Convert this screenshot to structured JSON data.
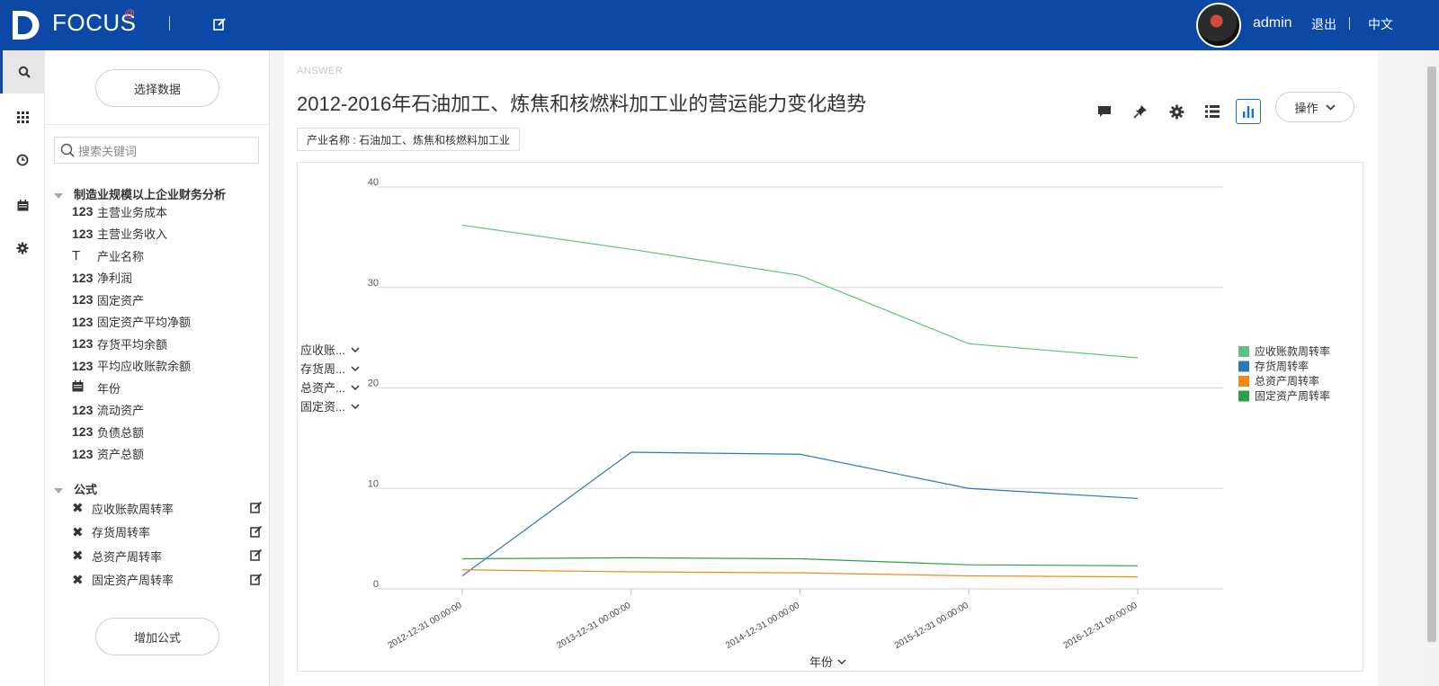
{
  "header": {
    "brand": "FOCUS",
    "brand_mark": "@",
    "user": "admin",
    "logout": "退出",
    "language": "中文"
  },
  "rail": {
    "items": [
      "search-icon",
      "apps-grid-icon",
      "history-clock-icon",
      "calendar-icon",
      "settings-gear-icon"
    ]
  },
  "panel": {
    "select_data_label": "选择数据",
    "search_placeholder": "搜索关键词",
    "dataset_title": "制造业规模以上企业财务分析",
    "fields": [
      {
        "type": "123",
        "label": "主营业务成本"
      },
      {
        "type": "123",
        "label": "主营业务收入"
      },
      {
        "type": "T",
        "label": "产业名称"
      },
      {
        "type": "123",
        "label": "净利润"
      },
      {
        "type": "123",
        "label": "固定资产"
      },
      {
        "type": "123",
        "label": "固定资产平均净额"
      },
      {
        "type": "123",
        "label": "存货平均余额"
      },
      {
        "type": "123",
        "label": "平均应收账款余额"
      },
      {
        "type": "date",
        "label": "年份"
      },
      {
        "type": "123",
        "label": "流动资产"
      },
      {
        "type": "123",
        "label": "负债总额"
      },
      {
        "type": "123",
        "label": "资产总额"
      }
    ],
    "formula_title": "公式",
    "formulas": [
      "应收账款周转率",
      "存货周转率",
      "总资产周转率",
      "固定资产周转率"
    ],
    "add_formula_label": "增加公式"
  },
  "main": {
    "answer_tag": "ANSWER",
    "title": "2012-2016年石油加工、炼焦和核燃料加工业的营运能力变化趋势",
    "filter_chip": "产业名称 : 石油加工、炼焦和核燃料加工业",
    "ops_label": "操作",
    "y_fields": [
      "应收账...",
      "存货周...",
      "总资产...",
      "固定资..."
    ],
    "x_field": "年份"
  },
  "chart_data": {
    "type": "line",
    "title": "",
    "xlabel": "年份",
    "ylabel": "",
    "ylim": [
      0,
      40
    ],
    "yticks": [
      0,
      10,
      20,
      30,
      40
    ],
    "grid": true,
    "legend_position": "right",
    "x": [
      "2012-12-31 00:00:00",
      "2013-12-31 00:00:00",
      "2014-12-31 00:00:00",
      "2015-12-31 00:00:00",
      "2016-12-31 00:00:00"
    ],
    "series": [
      {
        "name": "应收账款周转率",
        "color": "#5ec27d",
        "values": [
          36.2,
          33.8,
          31.2,
          24.4,
          23.0
        ]
      },
      {
        "name": "存货周转率",
        "color": "#2c77b8",
        "values": [
          1.3,
          13.6,
          13.4,
          10.0,
          9.0
        ]
      },
      {
        "name": "总资产周转率",
        "color": "#f08a1c",
        "values": [
          1.9,
          1.7,
          1.6,
          1.3,
          1.2
        ]
      },
      {
        "name": "固定资产周转率",
        "color": "#2ea043",
        "values": [
          3.0,
          3.1,
          3.0,
          2.4,
          2.3
        ]
      }
    ]
  }
}
